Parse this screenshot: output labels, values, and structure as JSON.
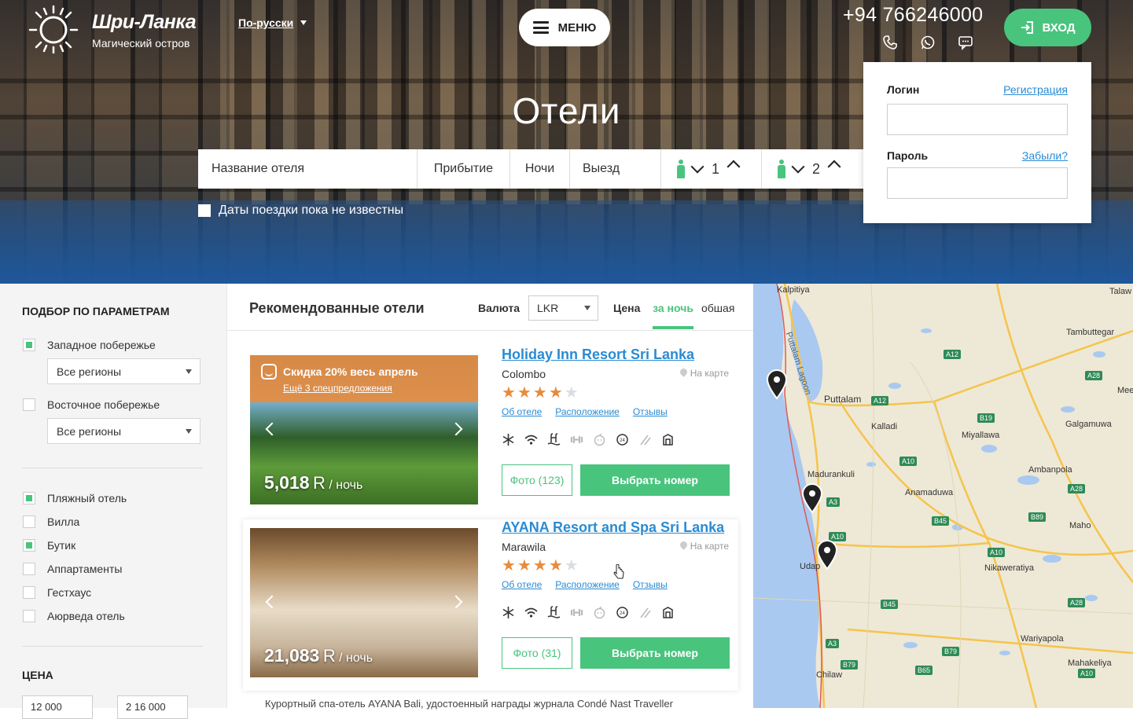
{
  "header": {
    "brand": "Шри-Ланка",
    "tagline": "Магический остров",
    "language": "По-русски",
    "menu_label": "МЕНЮ",
    "phone": "+94 766246000",
    "login_label": "ВХОД",
    "contact_icons": [
      "phone-icon",
      "whatsapp-icon",
      "chat-icon"
    ]
  },
  "login_panel": {
    "login_label": "Логин",
    "register_link": "Регистрация",
    "password_label": "Пароль",
    "forgot_link": "Забыли?"
  },
  "hero": {
    "title": "Отели",
    "search": {
      "hotel_name_placeholder": "Название отеля",
      "arrival": "Прибытие",
      "nights": "Ночи",
      "departure": "Выезд",
      "rooms_count": "1",
      "guests_count": "2"
    },
    "dates_unknown": "Даты поездки пока не известны"
  },
  "sidebar": {
    "title": "ПОДБОР ПО ПАРАМЕТРАМ",
    "regions": [
      {
        "label": "Западное побережье",
        "checked": true,
        "select": "Все регионы"
      },
      {
        "label": "Восточное побережье",
        "checked": false,
        "select": "Все регионы"
      }
    ],
    "types": [
      {
        "label": "Пляжный отель",
        "checked": true
      },
      {
        "label": "Вилла",
        "checked": false
      },
      {
        "label": "Бутик",
        "checked": true
      },
      {
        "label": "Аппартаменты",
        "checked": false
      },
      {
        "label": "Гестхаус",
        "checked": false
      },
      {
        "label": "Аюрведа отель",
        "checked": false
      }
    ],
    "price_title": "ЦЕНА",
    "price_from": "12 000",
    "price_to": "2 16 000"
  },
  "main": {
    "title": "Рекомендованные отели",
    "currency_label": "Валюта",
    "currency": "LKR",
    "price_label": "Цена",
    "tab_per_night": "за ночь",
    "tab_total": "обшая",
    "hotels": [
      {
        "name": "Holiday Inn Resort Sri Lanka",
        "city": "Colombo",
        "map_link": "На карте",
        "stars": 4,
        "links": [
          "Об отеле",
          "Расположение",
          "Отзывы"
        ],
        "promo_title": "Скидка 20% весь апрель",
        "promo_link": "Ещё 3 спецпредложения",
        "price": "5,018",
        "currency": "R",
        "per": "/ ночь",
        "photos_label": "Фото (123)",
        "select_label": "Выбрать номер"
      },
      {
        "name": "AYANA Resort and Spa Sri Lanka",
        "city": "Marawila",
        "map_link": "На карте",
        "stars": 4,
        "links": [
          "Об отеле",
          "Расположение",
          "Отзывы"
        ],
        "price": "21,083",
        "currency": "R",
        "per": "/ ночь",
        "photos_label": "Фото (31)",
        "select_label": "Выбрать номер"
      }
    ],
    "description": "Курортный спа-отель AYANA Bali, удостоенный награды журнала Condé Nast Traveller"
  },
  "map": {
    "places": [
      "Kalpitiya",
      "Puttalam Lagoon",
      "Puttalam",
      "Tambuttegar",
      "Kalladi",
      "Miyallawa",
      "Galgamuwa",
      "Madurankuli",
      "Anamaduwa",
      "Ambanpola",
      "Maho",
      "Udap",
      "Nikaweratiya",
      "Wariyapola",
      "Mahakeliya",
      "Chilaw",
      "Talaw",
      "Mee"
    ],
    "roads": [
      "A12",
      "A12",
      "A28",
      "B19",
      "A10",
      "A3",
      "A28",
      "B45",
      "B89",
      "A10",
      "A10",
      "B45",
      "A28",
      "A3",
      "B79",
      "B79",
      "B65",
      "A10"
    ],
    "colors": {
      "accent": "#49c47d",
      "link": "#2a8bd2",
      "promo": "#e88b3c",
      "water": "#a9c9f0",
      "land": "#eee8d6"
    }
  }
}
